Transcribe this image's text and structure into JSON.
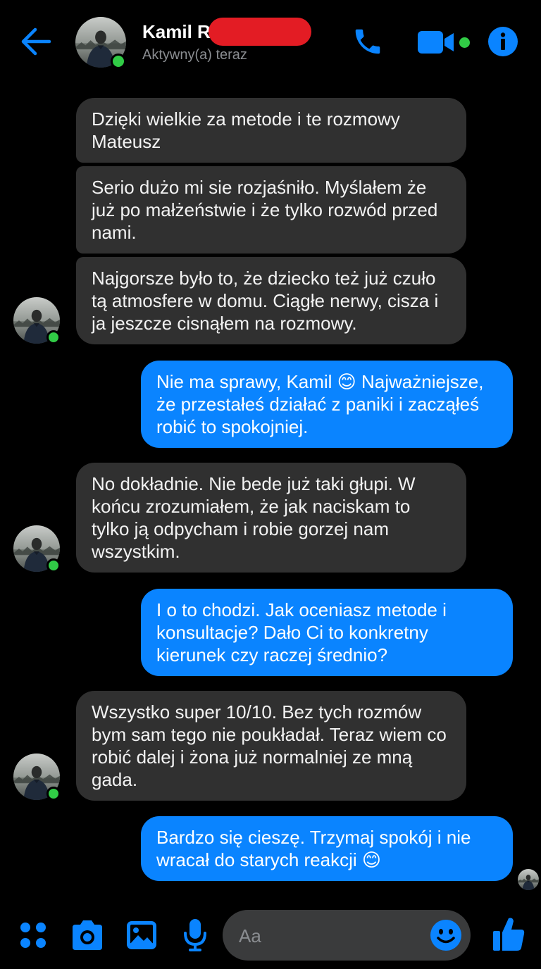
{
  "header": {
    "contact_name": "Kamil R",
    "status": "Aktywny(a) teraz"
  },
  "icons": {
    "back": "back-arrow-icon",
    "phone": "phone-icon",
    "video": "video-camera-icon",
    "info": "info-icon",
    "apps": "apps-grid-icon",
    "camera": "camera-icon",
    "gallery": "gallery-icon",
    "mic": "microphone-icon",
    "emoji": "emoji-icon",
    "like": "thumbs-up-icon"
  },
  "colors": {
    "accent": "#0a84ff",
    "incoming_bubble": "#303030",
    "online": "#31cc46",
    "redaction": "#e31c24"
  },
  "messages": [
    {
      "from": "contact",
      "text": "Dzięki wielkie za metode i te rozmowy Mateusz"
    },
    {
      "from": "contact",
      "text": "Serio dużo mi sie rozjaśniło. Myślałem że już po małżeństwie i że tylko rozwód przed nami."
    },
    {
      "from": "contact",
      "text": "Najgorsze było to, że dziecko też już czuło tą atmosfere w domu. Ciągłe nerwy, cisza i ja jeszcze cisnąłem na rozmowy."
    },
    {
      "from": "me",
      "text": "Nie ma sprawy, Kamil 😊 Najważniejsze, że przestałeś działać z paniki i zacząłeś robić to spokojniej."
    },
    {
      "from": "contact",
      "text": "No dokładnie. Nie bede już taki głupi. W końcu zrozumiałem, że jak naciskam to tylko ją odpycham i robie gorzej nam wszystkim."
    },
    {
      "from": "me",
      "text": "I o to chodzi. Jak oceniasz metode i konsultacje? Dało Ci to konkretny kierunek czy raczej średnio?"
    },
    {
      "from": "contact",
      "text": "Wszystko super 10/10. Bez tych rozmów bym sam tego nie poukładał. Teraz wiem co robić dalej i żona już normalniej ze mną gada."
    },
    {
      "from": "me",
      "text": "Bardzo się cieszę. Trzymaj spokój i nie wracał do starych reakcji 😊"
    }
  ],
  "composer": {
    "placeholder": "Aa"
  }
}
